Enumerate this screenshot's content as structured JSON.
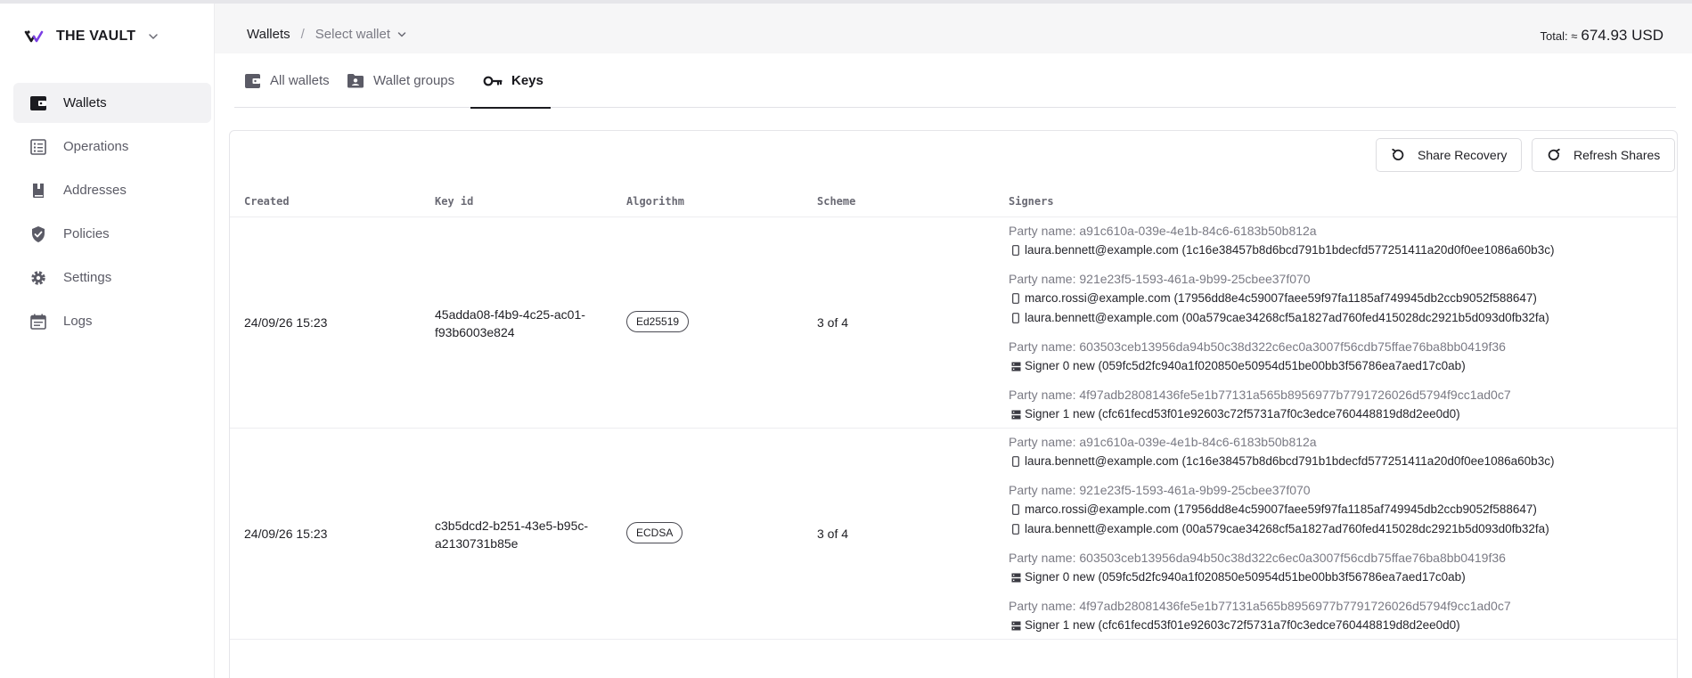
{
  "brand": {
    "name": "THE VAULT"
  },
  "nav": {
    "items": [
      {
        "label": "Wallets",
        "icon": "wallet-icon",
        "active": true
      },
      {
        "label": "Operations",
        "icon": "list-icon",
        "active": false
      },
      {
        "label": "Addresses",
        "icon": "book-icon",
        "active": false
      },
      {
        "label": "Policies",
        "icon": "shield-check-icon",
        "active": false
      },
      {
        "label": "Settings",
        "icon": "gear-icon",
        "active": false
      },
      {
        "label": "Logs",
        "icon": "calendar-icon",
        "active": false
      }
    ]
  },
  "header": {
    "breadcrumb_root": "Wallets",
    "breadcrumb_sep": "/",
    "wallet_select_placeholder": "Select wallet",
    "total_label": "Total: ≈",
    "total_value": "674.93 USD"
  },
  "tabs": [
    {
      "label": "All wallets",
      "icon": "wallet-icon",
      "active": false
    },
    {
      "label": "Wallet groups",
      "icon": "folder-user-icon",
      "active": false
    },
    {
      "label": "Keys",
      "icon": "key-icon",
      "active": true
    }
  ],
  "actions": {
    "share_recovery": "Share Recovery",
    "refresh_shares": "Refresh Shares"
  },
  "table": {
    "headers": {
      "created": "Created",
      "key_id": "Key id",
      "algorithm": "Algorithm",
      "scheme": "Scheme",
      "signers": "Signers"
    },
    "rows": [
      {
        "created": "24/09/26 15:23",
        "key_id_line1": "45adda08-f4b9-4c25-ac01-",
        "key_id_line2": "f93b6003e824",
        "algorithm": "Ed25519",
        "scheme": "3 of 4",
        "parties": [
          {
            "name": "Party name: a91c610a-039e-4e1b-84c6-6183b50b812a",
            "devices": [
              {
                "type": "phone",
                "text": "laura.bennett@example.com (1c16e38457b8d6bcd791b1bdecfd577251411a20d0f0ee1086a60b3c)"
              }
            ]
          },
          {
            "name": "Party name: 921e23f5-1593-461a-9b99-25cbee37f070",
            "devices": [
              {
                "type": "phone",
                "text": "marco.rossi@example.com (17956dd8e4c59007faee59f97fa1185af749945db2ccb9052f588647)"
              },
              {
                "type": "phone",
                "text": "laura.bennett@example.com (00a579cae34268cf5a1827ad760fed415028dc2921b5d093d0fb32fa)"
              }
            ]
          },
          {
            "name": "Party name: 603503ceb13956da94b50c38d322c6ec0a3007f56cdb75ffae76ba8bb0419f36",
            "devices": [
              {
                "type": "server",
                "text": "Signer 0 new (059fc5d2fc940a1f020850e50954d51be00bb3f56786ea7aed17c0ab)"
              }
            ]
          },
          {
            "name": "Party name: 4f97adb28081436fe5e1b77131a565b8956977b7791726026d5794f9cc1ad0c7",
            "devices": [
              {
                "type": "server",
                "text": "Signer 1 new (cfc61fecd53f01e92603c72f5731a7f0c3edce760448819d8d2ee0d0)"
              }
            ]
          }
        ]
      },
      {
        "created": "24/09/26 15:23",
        "key_id_line1": "c3b5dcd2-b251-43e5-b95c-",
        "key_id_line2": "a2130731b85e",
        "algorithm": "ECDSA",
        "scheme": "3 of 4",
        "parties": [
          {
            "name": "Party name: a91c610a-039e-4e1b-84c6-6183b50b812a",
            "devices": [
              {
                "type": "phone",
                "text": "laura.bennett@example.com (1c16e38457b8d6bcd791b1bdecfd577251411a20d0f0ee1086a60b3c)"
              }
            ]
          },
          {
            "name": "Party name: 921e23f5-1593-461a-9b99-25cbee37f070",
            "devices": [
              {
                "type": "phone",
                "text": "marco.rossi@example.com (17956dd8e4c59007faee59f97fa1185af749945db2ccb9052f588647)"
              },
              {
                "type": "phone",
                "text": "laura.bennett@example.com (00a579cae34268cf5a1827ad760fed415028dc2921b5d093d0fb32fa)"
              }
            ]
          },
          {
            "name": "Party name: 603503ceb13956da94b50c38d322c6ec0a3007f56cdb75ffae76ba8bb0419f36",
            "devices": [
              {
                "type": "server",
                "text": "Signer 0 new (059fc5d2fc940a1f020850e50954d51be00bb3f56786ea7aed17c0ab)"
              }
            ]
          },
          {
            "name": "Party name: 4f97adb28081436fe5e1b77131a565b8956977b7791726026d5794f9cc1ad0c7",
            "devices": [
              {
                "type": "server",
                "text": "Signer 1 new (cfc61fecd53f01e92603c72f5731a7f0c3edce760448819d8d2ee0d0)"
              }
            ]
          }
        ]
      }
    ]
  }
}
